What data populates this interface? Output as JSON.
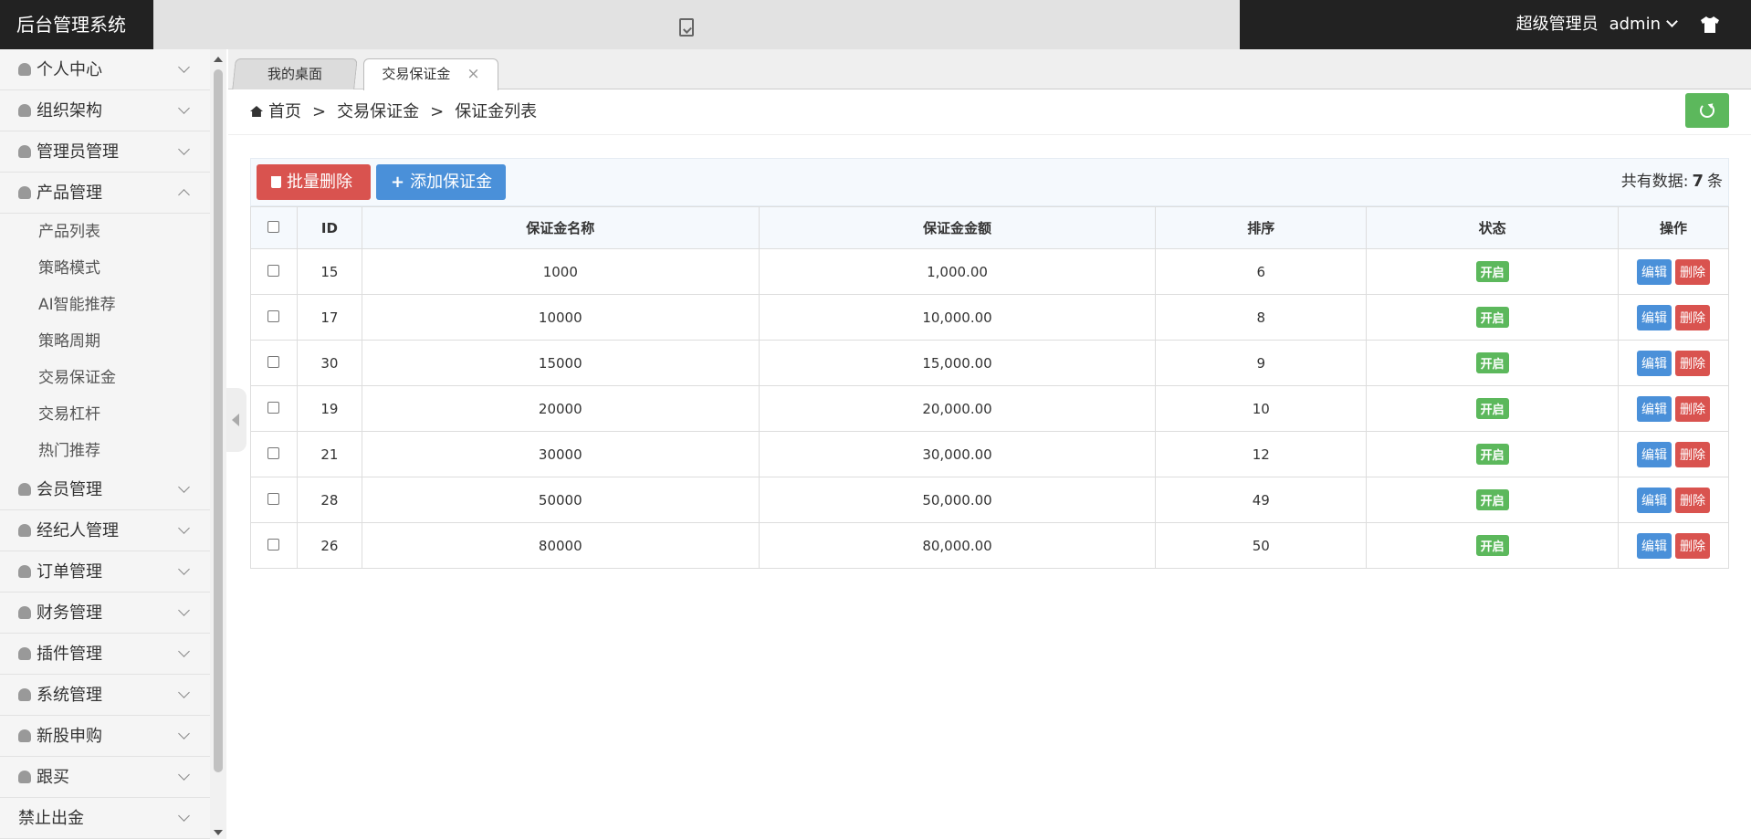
{
  "app": {
    "title": "后台管理系统"
  },
  "header": {
    "role": "超级管理员",
    "username": "admin"
  },
  "sidebar": {
    "items": [
      {
        "label": "个人中心"
      },
      {
        "label": "组织架构"
      },
      {
        "label": "管理员管理"
      },
      {
        "label": "产品管理"
      },
      {
        "label": "会员管理"
      },
      {
        "label": "经纪人管理"
      },
      {
        "label": "订单管理"
      },
      {
        "label": "财务管理"
      },
      {
        "label": "插件管理"
      },
      {
        "label": "系统管理"
      },
      {
        "label": "新股申购"
      },
      {
        "label": "跟买"
      },
      {
        "label": "禁止出金"
      }
    ],
    "product_sub": [
      "产品列表",
      "策略模式",
      "AI智能推荐",
      "策略周期",
      "交易保证金",
      "交易杠杆",
      "热门推荐"
    ]
  },
  "tabs": [
    {
      "label": "我的桌面"
    },
    {
      "label": "交易保证金",
      "close": "×"
    }
  ],
  "breadcrumb": {
    "home": "首页",
    "sep": ">",
    "level1": "交易保证金",
    "level2": "保证金列表"
  },
  "toolbar": {
    "batch_delete": "批量删除",
    "add": "添加保证金",
    "total_prefix": "共有数据:",
    "total_count": "7",
    "total_suffix": "条"
  },
  "table": {
    "headers": [
      "ID",
      "保证金名称",
      "保证金金额",
      "排序",
      "状态",
      "操作"
    ],
    "rows": [
      {
        "id": "15",
        "name": "1000",
        "amount": "1,000.00",
        "sort": "6",
        "status": "开启"
      },
      {
        "id": "17",
        "name": "10000",
        "amount": "10,000.00",
        "sort": "8",
        "status": "开启"
      },
      {
        "id": "30",
        "name": "15000",
        "amount": "15,000.00",
        "sort": "9",
        "status": "开启"
      },
      {
        "id": "19",
        "name": "20000",
        "amount": "20,000.00",
        "sort": "10",
        "status": "开启"
      },
      {
        "id": "21",
        "name": "30000",
        "amount": "30,000.00",
        "sort": "12",
        "status": "开启"
      },
      {
        "id": "28",
        "name": "50000",
        "amount": "50,000.00",
        "sort": "49",
        "status": "开启"
      },
      {
        "id": "26",
        "name": "80000",
        "amount": "80,000.00",
        "sort": "50",
        "status": "开启"
      }
    ],
    "edit_label": "编辑",
    "delete_label": "删除"
  },
  "colors": {
    "danger": "#d9534f",
    "primary": "#4a90d9",
    "success": "#5cb85c",
    "topbar": "#222222"
  }
}
